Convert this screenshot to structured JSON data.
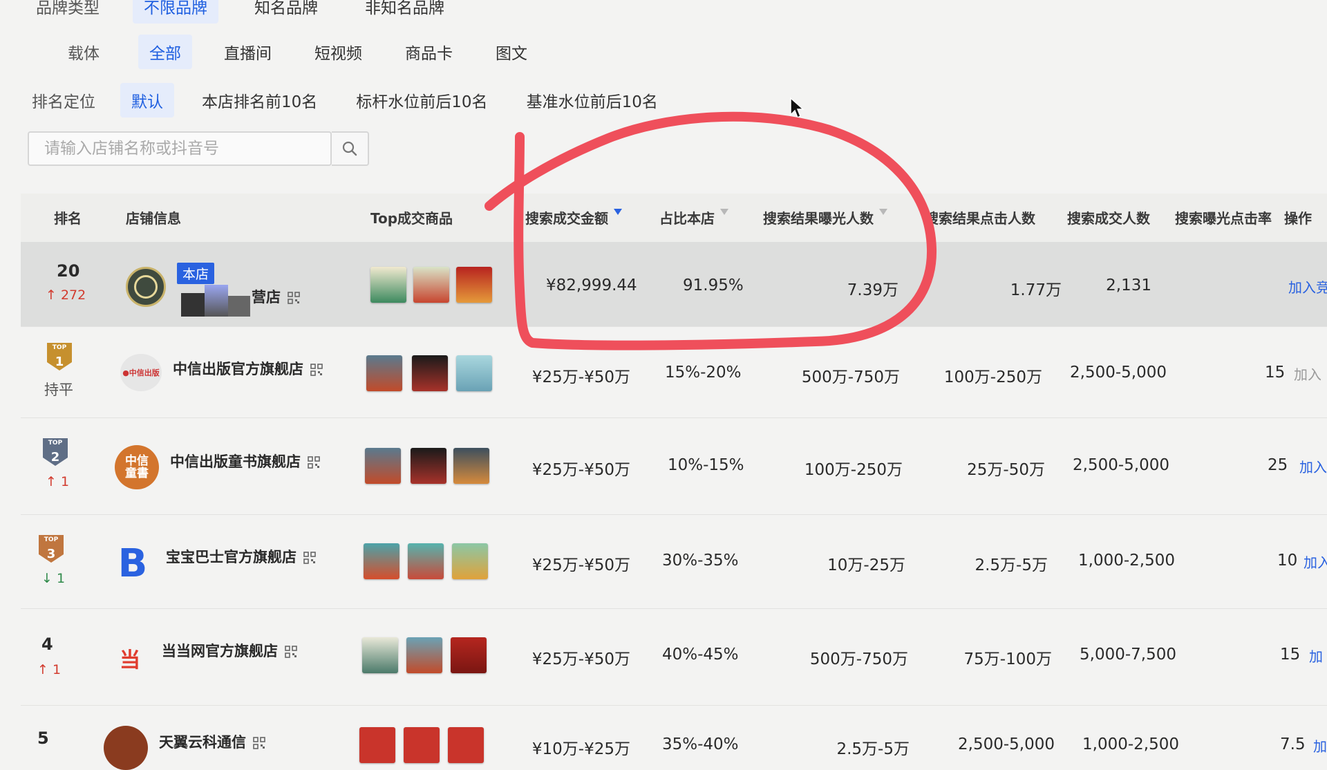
{
  "filters": {
    "brand_type": {
      "label": "品牌类型",
      "options": [
        "不限品牌",
        "知名品牌",
        "非知名品牌"
      ],
      "selected": "不限品牌"
    },
    "carrier": {
      "label": "载体",
      "options": [
        "全部",
        "直播间",
        "短视频",
        "商品卡",
        "图文"
      ],
      "selected": "全部"
    },
    "rank_position": {
      "label": "排名定位",
      "options": [
        "默认",
        "本店排名前10名",
        "标杆水位前后10名",
        "基准水位前后10名"
      ],
      "selected": "默认"
    }
  },
  "search": {
    "placeholder": "请输入店铺名称或抖音号",
    "value": ""
  },
  "table": {
    "headers": [
      "排名",
      "店铺信息",
      "Top成交商品",
      "搜索成交金额",
      "占比本店",
      "搜索结果曝光人数",
      "搜索结果点击人数",
      "搜索成交人数",
      "搜索曝光点击率",
      "操作"
    ],
    "sorted_column": "搜索成交金额",
    "rows": [
      {
        "rank": "20",
        "change": "272",
        "direction": "up",
        "own_tag": "本店",
        "shop": "营店",
        "gmv": "¥82,999.44",
        "share": "91.95%",
        "exposure": "7.39万",
        "clicks": "1.77万",
        "buyers": "2,131",
        "ctr": "",
        "action": "加入竞"
      },
      {
        "rank": "1",
        "change": "持平",
        "direction": "flat",
        "shop": "中信出版官方旗舰店",
        "gmv": "¥25万-¥50万",
        "share": "15%-20%",
        "exposure": "500万-750万",
        "clicks": "100万-250万",
        "buyers": "2,500-5,000",
        "ctr": "15",
        "action": "加入"
      },
      {
        "rank": "2",
        "change": "1",
        "direction": "up",
        "shop": "中信出版童书旗舰店",
        "gmv": "¥25万-¥50万",
        "share": "10%-15%",
        "exposure": "100万-250万",
        "clicks": "25万-50万",
        "buyers": "2,500-5,000",
        "ctr": "25",
        "action": "加入"
      },
      {
        "rank": "3",
        "change": "1",
        "direction": "down",
        "shop": "宝宝巴士官方旗舰店",
        "gmv": "¥25万-¥50万",
        "share": "30%-35%",
        "exposure": "10万-25万",
        "clicks": "2.5万-5万",
        "buyers": "1,000-2,500",
        "ctr": "10",
        "action": "加入"
      },
      {
        "rank": "4",
        "change": "1",
        "direction": "up",
        "shop": "当当网官方旗舰店",
        "gmv": "¥25万-¥50万",
        "share": "40%-45%",
        "exposure": "500万-750万",
        "clicks": "75万-100万",
        "buyers": "5,000-7,500",
        "ctr": "15",
        "action": "加"
      },
      {
        "rank": "5",
        "change": "",
        "direction": "",
        "shop": "天翼云科通信",
        "gmv": "¥10万-¥25万",
        "share": "35%-40%",
        "exposure": "2.5万-5万",
        "clicks": "2,500-5,000",
        "buyers": "1,000-2,500",
        "ctr": "7.5",
        "action": "加"
      }
    ]
  },
  "badges": {
    "top": "TOP"
  },
  "colors": {
    "accent": "#2a62e0",
    "up": "#d23b2e",
    "down": "#2f8a4a",
    "annotation": "#ef4f5b"
  }
}
